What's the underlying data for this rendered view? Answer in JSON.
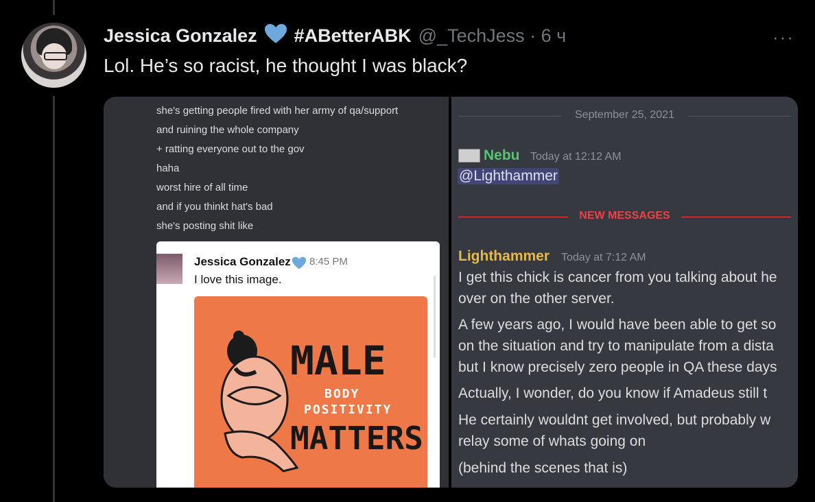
{
  "tweet": {
    "author_name": "Jessica Gonzalez",
    "hashtag": "#ABetterABK",
    "handle_time": "@_TechJess · 6 ч",
    "more": "···",
    "text": "Lol. He’s so racist, he thought I was black?",
    "heart_color": "#6fa8dc"
  },
  "left_dm": {
    "lines": [
      "she's getting people fired with her army of qa/support",
      "and ruining the whole company",
      "+ ratting everyone out to the gov",
      "haha",
      "worst hire of all time",
      "and if you thinkt hat's bad",
      "she's posting shit like"
    ],
    "embed": {
      "name": "Jessica Gonzalez",
      "time": "8:45 PM",
      "text": "I love this image.",
      "poster_title_1": "MALE",
      "poster_sub_1": "BODY",
      "poster_sub_2": "POSITIVITY",
      "poster_title_2": "MATTERS"
    }
  },
  "discord": {
    "date": "September 25, 2021",
    "msg1_author": "Nebu",
    "msg1_time": "Today at 12:12 AM",
    "msg1_mention": "@Lighthammer",
    "new_messages": "NEW MESSAGES",
    "msg2_author": "Lighthammer",
    "msg2_time": "Today at 7:12 AM",
    "msg2_lines": [
      "I get this chick is cancer from you talking about he",
      "over on the other server.",
      "A few years ago, I would have been able to get so",
      "on the situation and try to manipulate from a dista",
      "but I know precisely zero people in QA these days",
      "Actually, I wonder, do you know if Amadeus still t",
      "He certainly wouldnt get involved, but probably w",
      "relay some of whats going on",
      "(behind the scenes that is)"
    ],
    "colors": {
      "nebu": "#57c46f",
      "lighthammer": "#e6b94a"
    }
  }
}
